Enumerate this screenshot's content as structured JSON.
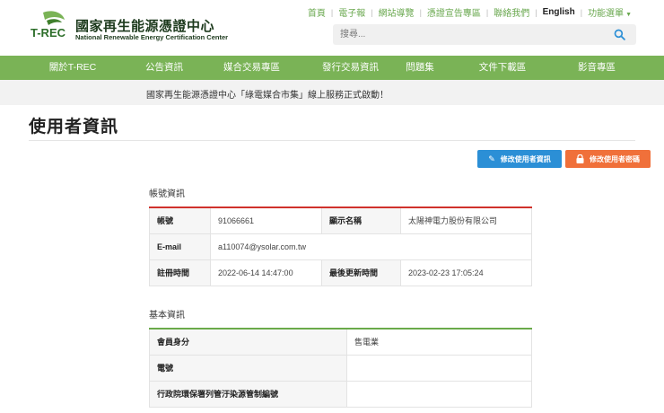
{
  "brand": {
    "logo_text": "T-REC",
    "name_zh": "國家再生能源憑證中心",
    "name_en": "National Renewable Energy Certification Center"
  },
  "toplinks": [
    "首頁",
    "電子報",
    "網站導覽",
    "憑證宣告專區",
    "聯絡我們"
  ],
  "english_label": "English",
  "function_menu_label": "功能選單",
  "search": {
    "placeholder": "搜尋..."
  },
  "nav": [
    "關於T-REC",
    "公告資訊",
    "媒合交易專區",
    "發行交易資訊",
    "問題集",
    "文件下載區",
    "影音專區"
  ],
  "announcement": "國家再生能源憑證中心「綠電媒合市集」線上服務正式啟動！",
  "page_title": "使用者資訊",
  "buttons": {
    "edit_info": "修改使用者資訊",
    "edit_password": "修改使用者密碼"
  },
  "account": {
    "section_title": "帳號資訊",
    "account_label": "帳號",
    "account_value": "91066661",
    "display_name_label": "顯示名稱",
    "display_name_value": "太陽神電力股份有限公司",
    "email_label": "E-mail",
    "email_value": "a110074@ysolar.com.tw",
    "registered_label": "註冊時間",
    "registered_value": "2022-06-14 14:47:00",
    "updated_label": "最後更新時間",
    "updated_value": "2023-02-23 17:05:24"
  },
  "basic": {
    "section_title": "基本資訊",
    "member_type_label": "會員身分",
    "member_type_value": "售電業",
    "phone_label": "電號",
    "phone_value": "",
    "epa_label": "行政院環保署列管汙染源管制編號",
    "epa_value": ""
  },
  "colors": {
    "nav_green": "#7ab356",
    "link_green": "#6aa84f",
    "edit_blue": "#2b8fd6",
    "pwd_orange": "#f0703a",
    "account_accent": "#d0322c",
    "basic_accent": "#6aaa4a"
  },
  "icons": {
    "search": "search-icon",
    "edit": "edit-icon",
    "lock": "lock-icon"
  }
}
